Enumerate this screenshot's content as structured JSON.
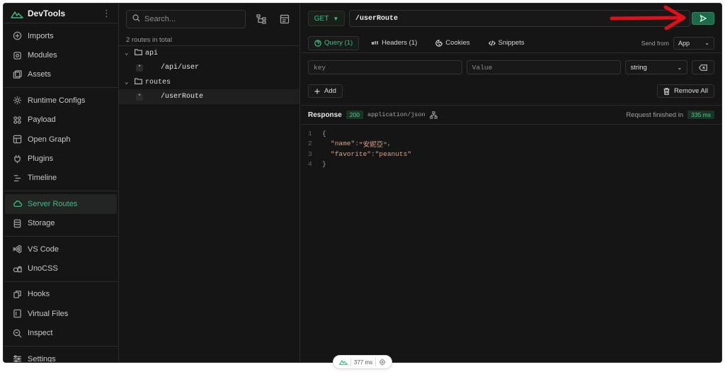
{
  "app": {
    "title": "DevTools"
  },
  "sidebar": {
    "groups": [
      [
        {
          "label": "Imports",
          "icon": "imports-icon"
        },
        {
          "label": "Modules",
          "icon": "modules-icon"
        },
        {
          "label": "Assets",
          "icon": "assets-icon"
        }
      ],
      [
        {
          "label": "Runtime Configs",
          "icon": "gear-icon"
        },
        {
          "label": "Payload",
          "icon": "payload-icon"
        },
        {
          "label": "Open Graph",
          "icon": "open-graph-icon"
        },
        {
          "label": "Plugins",
          "icon": "plug-icon"
        },
        {
          "label": "Timeline",
          "icon": "timeline-icon"
        }
      ],
      [
        {
          "label": "Server Routes",
          "icon": "cloud-icon",
          "active": true
        },
        {
          "label": "Storage",
          "icon": "storage-icon"
        }
      ],
      [
        {
          "label": "VS Code",
          "icon": "vscode-icon"
        },
        {
          "label": "UnoCSS",
          "icon": "unocss-icon"
        }
      ],
      [
        {
          "label": "Hooks",
          "icon": "hooks-icon"
        },
        {
          "label": "Virtual Files",
          "icon": "virtual-files-icon"
        },
        {
          "label": "Inspect",
          "icon": "inspect-icon"
        }
      ],
      [
        {
          "label": "Settings",
          "icon": "settings-icon"
        }
      ]
    ]
  },
  "routes": {
    "search_placeholder": "Search...",
    "count_text": "2 routes in total",
    "tree": [
      {
        "folder": "api",
        "routes": [
          {
            "method": "*",
            "path": "/api/user"
          }
        ]
      },
      {
        "folder": "routes",
        "routes": [
          {
            "method": "*",
            "path": "/userRoute",
            "selected": true
          }
        ]
      }
    ]
  },
  "request": {
    "method": "GET",
    "url": "/userRoute",
    "tabs": [
      {
        "label": "Query (1)",
        "icon": "help-icon",
        "active": true
      },
      {
        "label": "Headers (1)",
        "icon": "http-icon"
      },
      {
        "label": "Cookies",
        "icon": "cookie-icon"
      },
      {
        "label": "Snippets",
        "icon": "code-icon"
      }
    ],
    "send_from_label": "Send from",
    "send_from_value": "App",
    "param_key_placeholder": "key",
    "param_value_placeholder": "Value",
    "param_type": "string",
    "add_label": "Add",
    "remove_all_label": "Remove All"
  },
  "response": {
    "label": "Response",
    "status": "200",
    "content_type": "application/json",
    "finished_label": "Request finished in",
    "duration": "335 ms",
    "body_lines": [
      {
        "n": "1",
        "text": "{"
      },
      {
        "n": "2",
        "key": "\"name\"",
        "value": "\"安妮亞\"",
        "trail": ","
      },
      {
        "n": "3",
        "key": "\"favorite\"",
        "value": "\"peanuts\"",
        "trail": ""
      },
      {
        "n": "4",
        "text": "}"
      }
    ]
  },
  "footer": {
    "timing": "377 ms"
  },
  "colors": {
    "accent": "#3dbb84",
    "annotation": "#e0101a",
    "background": "#151515"
  }
}
